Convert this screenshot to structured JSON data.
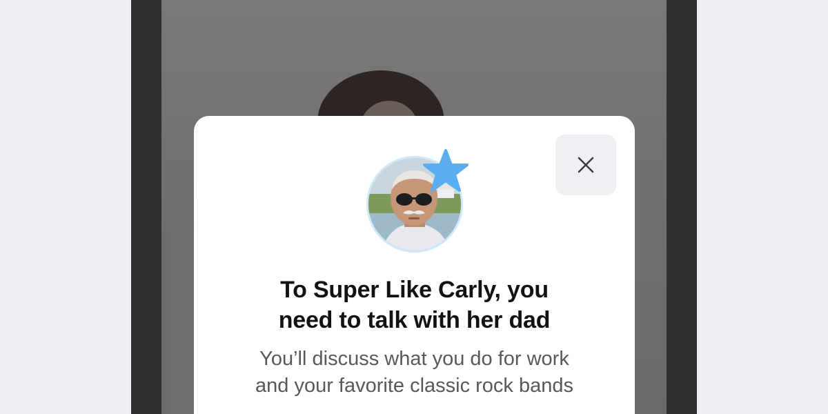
{
  "modal": {
    "title_line1": "To Super Like Carly, you",
    "title_line2": "need to talk with her dad",
    "subtitle_line1": "You’ll discuss what you do for work",
    "subtitle_line2": "and your favorite classic rock bands",
    "close_icon": "close-icon",
    "avatar_icon": "avatar-dad",
    "badge_icon": "super-like-star-icon"
  },
  "colors": {
    "modal_bg": "#ffffff",
    "close_button_bg": "#eef0f3",
    "star": "#5aaef0",
    "avatar_ring": "#cfe9fb",
    "title": "#111214",
    "subtitle": "#55585d",
    "phone_frame": "#2f2f30",
    "page_bg": "#eceef2"
  }
}
